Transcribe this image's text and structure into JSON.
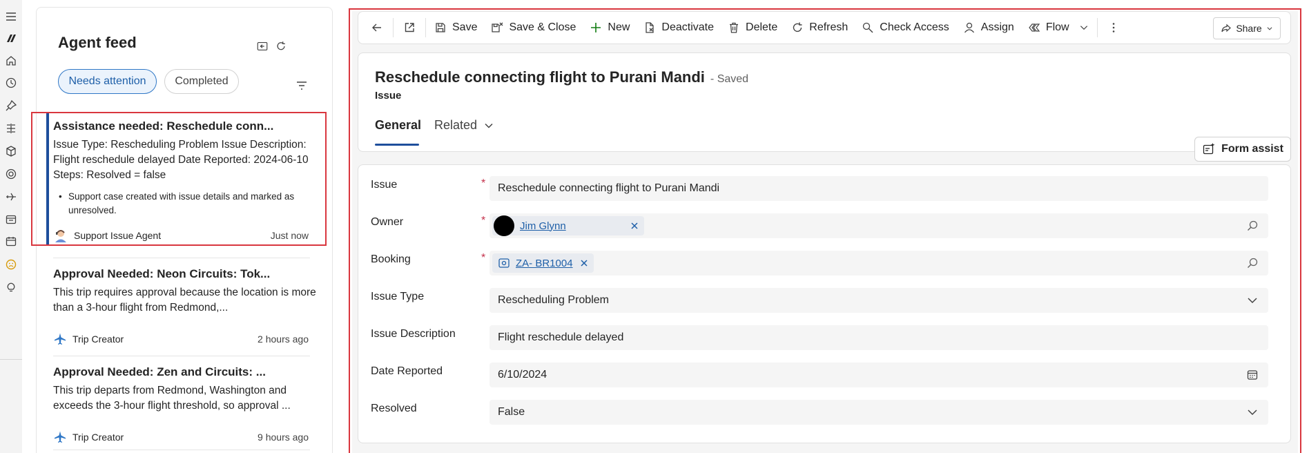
{
  "feed": {
    "title": "Agent feed",
    "filters": {
      "active": "Needs attention",
      "other": "Completed"
    },
    "items": [
      {
        "title": "Assistance needed: Reschedule conn...",
        "body": "Issue Type: Rescheduling Problem Issue Description: Flight reschedule delayed Date Reported: 2024-06-10 Steps: Resolved = false",
        "bullet": "Support case created with issue details and marked as unresolved.",
        "agent": "Support Issue Agent",
        "time": "Just now",
        "agent_icon": "support-agent-avatar-icon"
      },
      {
        "title": "Approval Needed: Neon Circuits: Tok...",
        "body": "This trip requires approval because the location is more than a 3-hour flight from Redmond,...",
        "agent": "Trip Creator",
        "time": "2 hours ago",
        "agent_icon": "airplane-icon"
      },
      {
        "title": "Approval Needed: Zen and Circuits: ...",
        "body": "This trip departs from Redmond, Washington and exceeds the 3-hour flight threshold, so approval ...",
        "agent": "Trip Creator",
        "time": "9 hours ago",
        "agent_icon": "airplane-icon"
      }
    ]
  },
  "commandbar": {
    "save": "Save",
    "save_close": "Save & Close",
    "new": "New",
    "deactivate": "Deactivate",
    "delete": "Delete",
    "refresh": "Refresh",
    "check_access": "Check Access",
    "assign": "Assign",
    "flow": "Flow",
    "share": "Share"
  },
  "record": {
    "title": "Reschedule connecting flight to Purani Mandi",
    "status": "- Saved",
    "entity": "Issue",
    "tabs": {
      "general": "General",
      "related": "Related"
    },
    "form_assist": "Form assist"
  },
  "form": {
    "issue": {
      "label": "Issue",
      "value": "Reschedule connecting flight to Purani Mandi"
    },
    "owner": {
      "label": "Owner",
      "value": "Jim Glynn"
    },
    "booking": {
      "label": "Booking",
      "value": "ZA- BR1004"
    },
    "issue_type": {
      "label": "Issue Type",
      "value": "Rescheduling Problem"
    },
    "issue_description": {
      "label": "Issue Description",
      "value": "Flight reschedule delayed"
    },
    "date_reported": {
      "label": "Date Reported",
      "value": "6/10/2024"
    },
    "resolved": {
      "label": "Resolved",
      "value": "False"
    }
  },
  "colors": {
    "accent": "#1e4e9c",
    "highlight": "#d9363e",
    "chip_active_bg": "#ebf3fc",
    "link": "#1e5fa8"
  }
}
